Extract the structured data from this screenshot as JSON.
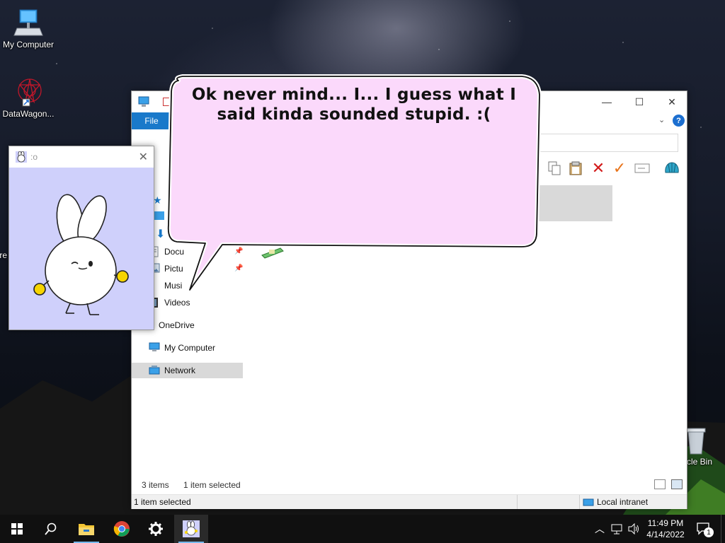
{
  "desktop": {
    "icons": [
      {
        "label": "My Computer",
        "icon": "computer-icon"
      },
      {
        "label": "DataWagon...",
        "icon": "datawagon-shortcut-icon"
      },
      {
        "label": "re",
        "icon": "partial-icon"
      },
      {
        "label": "cle Bin",
        "icon": "recycle-bin-icon"
      }
    ]
  },
  "pet_window": {
    "title": ":o",
    "icon": "bunny-icon"
  },
  "speech_bubble": {
    "text": "Ok never mind... I... I guess what I said kinda sounded stupid. :("
  },
  "explorer": {
    "ribbon": {
      "file_tab": "File"
    },
    "nav_items": [
      {
        "label": "Docu",
        "icon": "documents-icon",
        "pinned": true
      },
      {
        "label": "Pictu",
        "icon": "pictures-icon",
        "pinned": true
      },
      {
        "label": "Musi",
        "icon": "music-icon",
        "pinned": false
      },
      {
        "label": "Videos",
        "icon": "videos-icon",
        "pinned": false
      },
      {
        "label": "OneDrive",
        "icon": "onedrive-icon",
        "pinned": false
      },
      {
        "label": "My Computer",
        "icon": "computer-icon",
        "pinned": false
      },
      {
        "label": "Network",
        "icon": "network-icon",
        "pinned": false,
        "selected": true
      }
    ],
    "status": {
      "items": "3 items",
      "selected": "1 item selected"
    },
    "statusbar": {
      "left": "1 item selected",
      "zone": "Local intranet"
    }
  },
  "taskbar": {
    "apps": [
      "start-icon",
      "search-icon",
      "file-explorer-icon",
      "chrome-icon",
      "settings-icon",
      "bunny-app-icon"
    ],
    "clock": {
      "time": "11:49 PM",
      "date": "4/14/2022"
    },
    "notifications_count": "1"
  },
  "colors": {
    "accent": "#1979ca",
    "bubble_fill": "#fbd9fb",
    "pet_bg": "#cfd0fb",
    "taskbar": "#101010"
  }
}
